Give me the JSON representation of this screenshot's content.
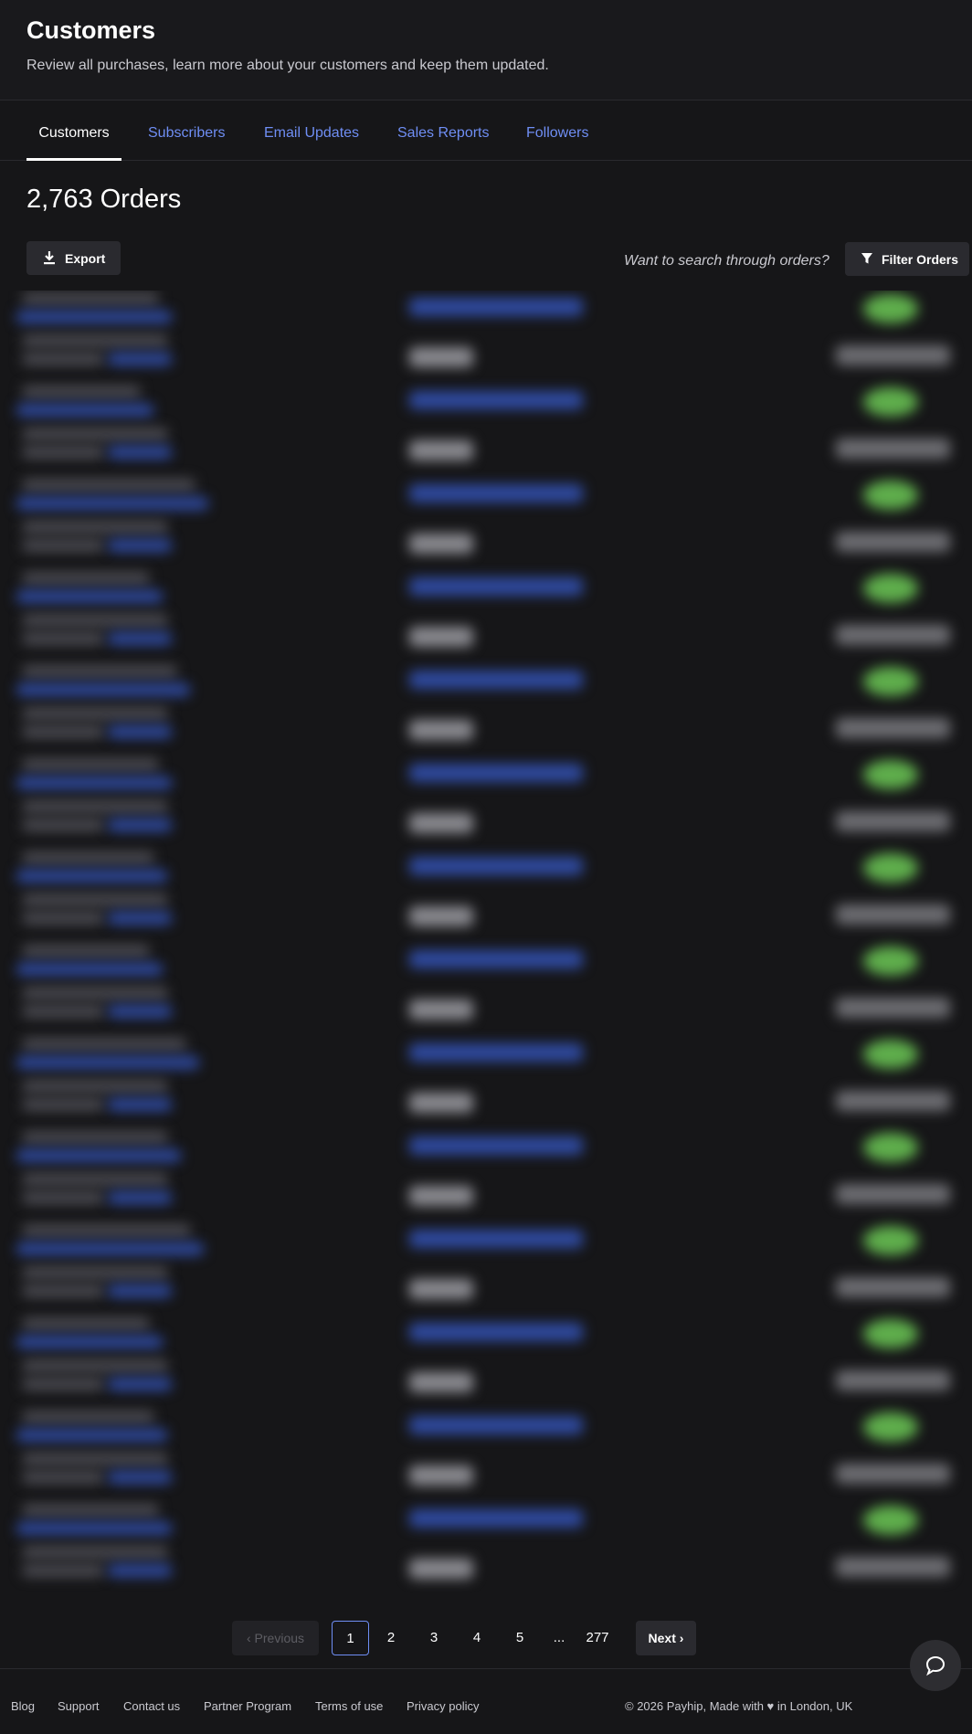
{
  "header": {
    "title": "Customers",
    "subtitle": "Review all purchases, learn more about your customers and keep them updated."
  },
  "tabs": [
    {
      "label": "Customers",
      "active": true
    },
    {
      "label": "Subscribers",
      "active": false
    },
    {
      "label": "Email Updates",
      "active": false
    },
    {
      "label": "Sales Reports",
      "active": false
    },
    {
      "label": "Followers",
      "active": false
    }
  ],
  "orders": {
    "count_label": "2,763 Orders",
    "export_label": "Export",
    "search_hint": "Want to search through orders?",
    "filter_label": "Filter Orders",
    "visible_rows": 14
  },
  "pagination": {
    "previous": "Previous",
    "pages": [
      "1",
      "2",
      "3",
      "4",
      "5"
    ],
    "current": "1",
    "ellipsis": "...",
    "last": "277",
    "next": "Next"
  },
  "footer": {
    "links": [
      "Blog",
      "Support",
      "Contact us",
      "Partner Program",
      "Terms of use",
      "Privacy policy"
    ],
    "copyright": "© 2026 Payhip, Made with ♥ in London, UK"
  },
  "icons": {
    "export": "download-icon",
    "filter": "filter-icon",
    "previous": "chevron-left-icon",
    "next": "chevron-right-icon",
    "chat": "chat-bubble-icon"
  },
  "colors": {
    "background": "#161618",
    "accent": "#6f8ef4",
    "status_green": "#5fae4c"
  }
}
